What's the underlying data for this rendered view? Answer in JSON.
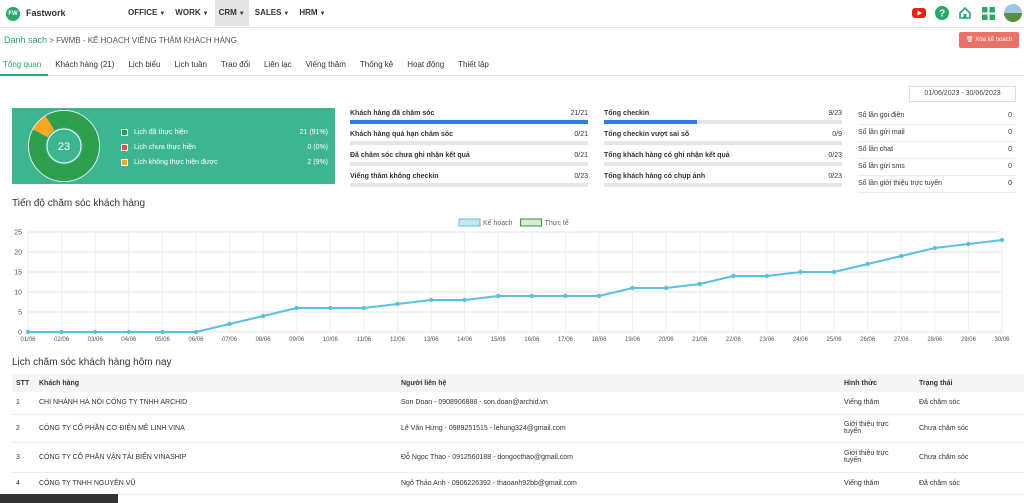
{
  "app": {
    "name": "Fastwork",
    "logo_text": "FW",
    "brand_color": "#2aa76a"
  },
  "nav": [
    {
      "label": "OFFICE",
      "active": false
    },
    {
      "label": "WORK",
      "active": false
    },
    {
      "label": "CRM",
      "active": true
    },
    {
      "label": "SALES",
      "active": false
    },
    {
      "label": "HRM",
      "active": false
    }
  ],
  "top_icons": [
    "youtube-icon",
    "help-icon",
    "home-icon",
    "apps-grid-icon",
    "avatar"
  ],
  "breadcrumb": {
    "root": "Danh sách",
    "separator": ">",
    "current": "FWMB - KẾ HOẠCH VIẾNG THĂM KHÁCH HÀNG"
  },
  "delete_button": {
    "label": "Xóa kế hoạch",
    "icon": "trash-icon",
    "color": "#ec7268"
  },
  "tabs": [
    "Tổng quan",
    "Khách hàng (21)",
    "Lịch biểu",
    "Lịch tuần",
    "Trao đổi",
    "Liên lạc",
    "Viếng thăm",
    "Thống kê",
    "Hoạt động",
    "Thiết lập"
  ],
  "active_tab": 0,
  "date_range": "01/06/2023 - 30/06/2023",
  "summary": {
    "total": "23",
    "card_color": "#3eb591",
    "items": [
      {
        "label": "Lịch đã thực hiện",
        "count": "21",
        "percent": "(91%)",
        "value": 21,
        "color": "#2e9e4f"
      },
      {
        "label": "Lịch chưa thực hiện",
        "count": "0",
        "percent": "(0%)",
        "value": 0,
        "color": "#e84c3d"
      },
      {
        "label": "Lịch không thực hiện được",
        "count": "2",
        "percent": "(9%)",
        "value": 2,
        "color": "#f5a623"
      }
    ]
  },
  "customer_stats": [
    {
      "label": "Khách hàng đã chăm sóc",
      "value": "21/21",
      "progress": 1.0
    },
    {
      "label": "Khách hàng quá hạn chăm sóc",
      "value": "0/21",
      "progress": 0
    },
    {
      "label": "Đã chăm sóc chưa ghi nhận kết quả",
      "value": "0/21",
      "progress": 0
    },
    {
      "label": "Viếng thăm không checkin",
      "value": "0/23",
      "progress": 0
    }
  ],
  "checkin_stats": [
    {
      "label": "Tổng checkin",
      "value": "9/23",
      "progress": 0.391
    },
    {
      "label": "Tổng checkin vượt sai số",
      "value": "0/9",
      "progress": 0
    },
    {
      "label": "Tổng khách hàng có ghi nhận kết quả",
      "value": "0/23",
      "progress": 0
    },
    {
      "label": "Tổng khách hàng có chụp ảnh",
      "value": "0/23",
      "progress": 0
    }
  ],
  "counters": [
    {
      "label": "Số lần gọi điện",
      "value": "0"
    },
    {
      "label": "Số lần gửi mail",
      "value": "0"
    },
    {
      "label": "Số lần chat",
      "value": "0"
    },
    {
      "label": "Số lần gửi sms",
      "value": "0"
    },
    {
      "label": "Số lần giới thiệu trực tuyến",
      "value": "0"
    }
  ],
  "progress_title": "Tiến độ chăm sóc khách hàng",
  "chart_data": {
    "type": "line",
    "legend_position": "top-center",
    "grid": true,
    "ylim": [
      0,
      25
    ],
    "yticks": [
      0,
      5,
      10,
      15,
      20,
      25
    ],
    "x": [
      "01/06",
      "02/06",
      "03/06",
      "04/06",
      "05/06",
      "06/06",
      "07/06",
      "08/06",
      "09/06",
      "10/06",
      "11/06",
      "12/06",
      "13/06",
      "14/06",
      "15/06",
      "16/06",
      "17/06",
      "18/06",
      "19/06",
      "20/06",
      "21/06",
      "22/06",
      "23/06",
      "24/06",
      "25/06",
      "26/06",
      "27/06",
      "28/06",
      "29/06",
      "30/06"
    ],
    "series": [
      {
        "name": "Kế hoạch",
        "color": "#a8d8ea",
        "values": []
      },
      {
        "name": "Thực tế",
        "color": "#5bc0de",
        "values": [
          0,
          0,
          0,
          0,
          0,
          0,
          2,
          4,
          6,
          6,
          6,
          7,
          8,
          8,
          9,
          9,
          9,
          9,
          11,
          11,
          12,
          14,
          14,
          15,
          15,
          17,
          19,
          21,
          22,
          23
        ]
      }
    ]
  },
  "table_title": "Lịch chăm sóc khách hàng hôm nay",
  "table": {
    "headers": [
      "STT",
      "Khách hàng",
      "Người liên hệ",
      "Hình thức",
      "Trạng thái"
    ],
    "rows": [
      [
        "1",
        "CHI NHÁNH HÀ NỘI CÔNG TY TNHH ARCHID",
        "Son Doan - 0908906888 - son.doan@archid.vn",
        "Viếng thăm",
        "Đã chăm sóc"
      ],
      [
        "2",
        "CÔNG TY CỔ PHẦN CƠ ĐIỆN MÊ LINH VINA",
        "Lê Văn Hưng - 0989251515 - lehung324@gmail.com",
        "Giới thiệu trực tuyến",
        "Chưa chăm sóc"
      ],
      [
        "3",
        "CÔNG TY CỔ PHẦN VẬN TẢI BIỂN VINASHIP",
        "Đỗ Ngọc Thao - 0912560188 - dongocthao@gmail.com",
        "Giới thiệu trực tuyến",
        "Chưa chăm sóc"
      ],
      [
        "4",
        "CÔNG TY TNHH NGUYÊN VŨ",
        "Ngô Thảo Anh - 0906226392 - thaoanh92bb@gmail.com",
        "Viếng thăm",
        "Đã chăm sóc"
      ]
    ]
  }
}
